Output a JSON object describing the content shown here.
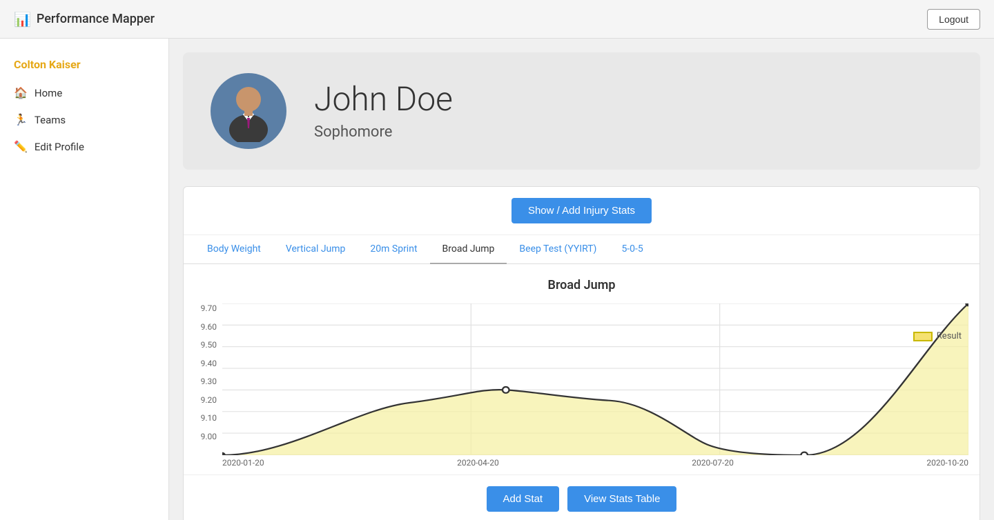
{
  "app": {
    "title": "Performance Mapper",
    "logo_icon": "📊"
  },
  "header": {
    "logout_label": "Logout"
  },
  "sidebar": {
    "user_name": "Colton Kaiser",
    "items": [
      {
        "id": "home",
        "label": "Home",
        "icon": "🏠"
      },
      {
        "id": "teams",
        "label": "Teams",
        "icon": "🏃"
      },
      {
        "id": "edit-profile",
        "label": "Edit Profile",
        "icon": "✏️"
      }
    ]
  },
  "profile": {
    "name": "John Doe",
    "year": "Sophomore"
  },
  "stats": {
    "show_injury_label": "Show / Add Injury Stats",
    "active_tab": "Broad Jump",
    "tabs": [
      {
        "id": "body-weight",
        "label": "Body Weight"
      },
      {
        "id": "vertical-jump",
        "label": "Vertical Jump"
      },
      {
        "id": "20m-sprint",
        "label": "20m Sprint"
      },
      {
        "id": "broad-jump",
        "label": "Broad Jump"
      },
      {
        "id": "beep-test",
        "label": "Beep Test (YYIRT)"
      },
      {
        "id": "5-0-5",
        "label": "5-0-5"
      }
    ],
    "chart": {
      "title": "Broad Jump",
      "legend_label": "Result",
      "y_labels": [
        "9.70",
        "9.60",
        "9.50",
        "9.40",
        "9.30",
        "9.20",
        "9.10",
        "9.00"
      ],
      "x_labels": [
        "2020-01-20",
        "2020-04-20",
        "2020-07-20",
        "2020-10-20"
      ],
      "data_points": [
        {
          "x": 0.0,
          "y": 9.0
        },
        {
          "x": 0.25,
          "y": 9.24
        },
        {
          "x": 0.38,
          "y": 9.3
        },
        {
          "x": 0.52,
          "y": 9.25
        },
        {
          "x": 0.65,
          "y": 9.05
        },
        {
          "x": 0.78,
          "y": 9.0
        },
        {
          "x": 1.0,
          "y": 9.7
        }
      ],
      "y_min": 9.0,
      "y_max": 9.7
    }
  },
  "actions": {
    "add_stat_label": "Add Stat",
    "view_table_label": "View Stats Table"
  }
}
